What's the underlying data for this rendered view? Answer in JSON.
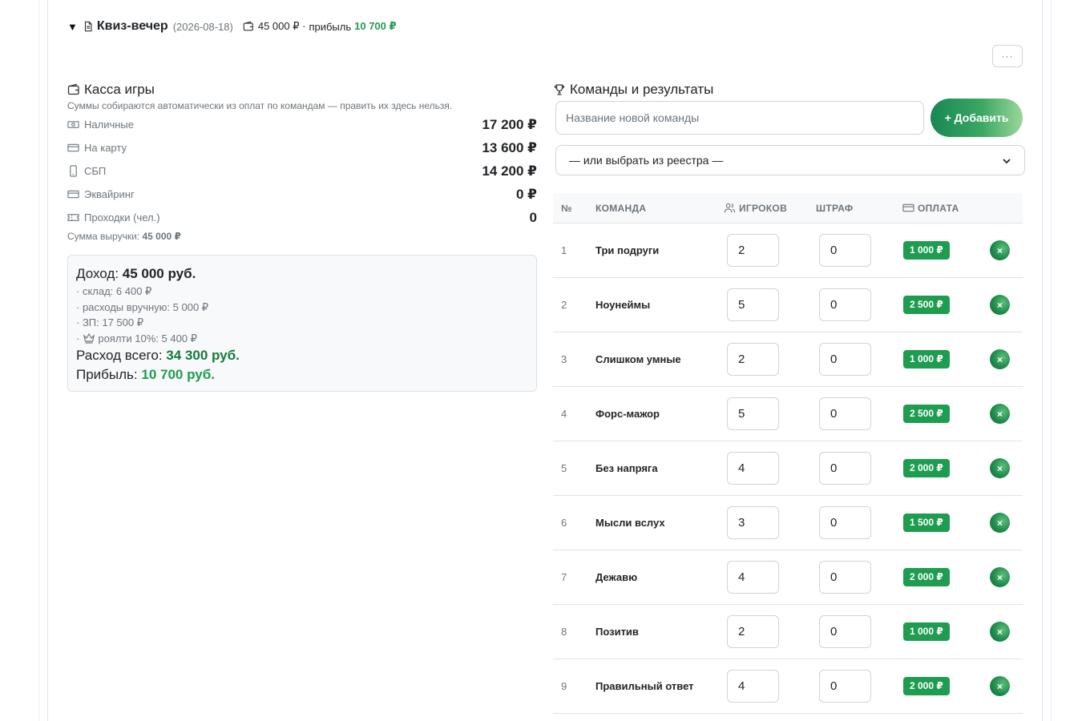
{
  "game": {
    "title": "Квиз-вечер",
    "date": "(2026-08-18)",
    "total": "45 000 ₽ ·",
    "profit_label": "прибыль",
    "profit": "10 700 ₽",
    "more_label": "···"
  },
  "cash": {
    "title": "Касса игры",
    "note": "Суммы собираются автоматически из оплат по командам — править их здесь нельзя.",
    "rows": [
      {
        "icon": "cash-icon",
        "label": "Наличные",
        "value": "17 200 ₽"
      },
      {
        "icon": "card-icon",
        "label": "На карту",
        "value": "13 600 ₽"
      },
      {
        "icon": "phone-icon",
        "label": "СБП",
        "value": "14 200 ₽"
      },
      {
        "icon": "card-icon",
        "label": "Эквайринг",
        "value": "0 ₽"
      },
      {
        "icon": "ticket-icon",
        "label": "Проходки (чел.)",
        "value": "0"
      }
    ],
    "revenue_label": "Сумма выручки:",
    "revenue_value": "45 000 ₽"
  },
  "pl": {
    "income_label": "Доход:",
    "income_value": "45 000 руб.",
    "items": [
      "· склад: 6 400 ₽",
      "· расходы вручную: 5 000 ₽",
      "· ЗП: 17 500 ₽"
    ],
    "royalty_prefix": "·",
    "royalty": "роялти 10%: 5 400 ₽",
    "expense_label": "Расход всего:",
    "expense_value": "34 300 руб.",
    "profit_label": "Прибыль:",
    "profit_value": "10 700 руб."
  },
  "teams": {
    "title": "Команды и результаты",
    "new_team_placeholder": "Название новой команды",
    "add_button": "+ Добавить",
    "registry_select": "— или выбрать из реестра —",
    "headers": {
      "num": "№",
      "team": "КОМАНДА",
      "players": "ИГРОКОВ",
      "fine": "ШТРАФ",
      "pay": "ОПЛАТА"
    },
    "rows": [
      {
        "num": "1",
        "name": "Три подруги",
        "players": "2",
        "fine": "0",
        "pay": "1 000 ₽"
      },
      {
        "num": "2",
        "name": "Ноунеймы",
        "players": "5",
        "fine": "0",
        "pay": "2 500 ₽"
      },
      {
        "num": "3",
        "name": "Слишком умные",
        "players": "2",
        "fine": "0",
        "pay": "1 000 ₽"
      },
      {
        "num": "4",
        "name": "Форс-мажор",
        "players": "5",
        "fine": "0",
        "pay": "2 500 ₽"
      },
      {
        "num": "5",
        "name": "Без напряга",
        "players": "4",
        "fine": "0",
        "pay": "2 000 ₽"
      },
      {
        "num": "6",
        "name": "Мысли вслух",
        "players": "3",
        "fine": "0",
        "pay": "1 500 ₽"
      },
      {
        "num": "7",
        "name": "Дежавю",
        "players": "4",
        "fine": "0",
        "pay": "2 000 ₽"
      },
      {
        "num": "8",
        "name": "Позитив",
        "players": "2",
        "fine": "0",
        "pay": "1 000 ₽"
      },
      {
        "num": "9",
        "name": "Правильный ответ",
        "players": "4",
        "fine": "0",
        "pay": "2 000 ₽"
      }
    ],
    "delete_label": "×"
  },
  "colors": {
    "accent_green": "#1e9c4f",
    "dark_green": "#157a3c",
    "muted": "#6c757d"
  }
}
